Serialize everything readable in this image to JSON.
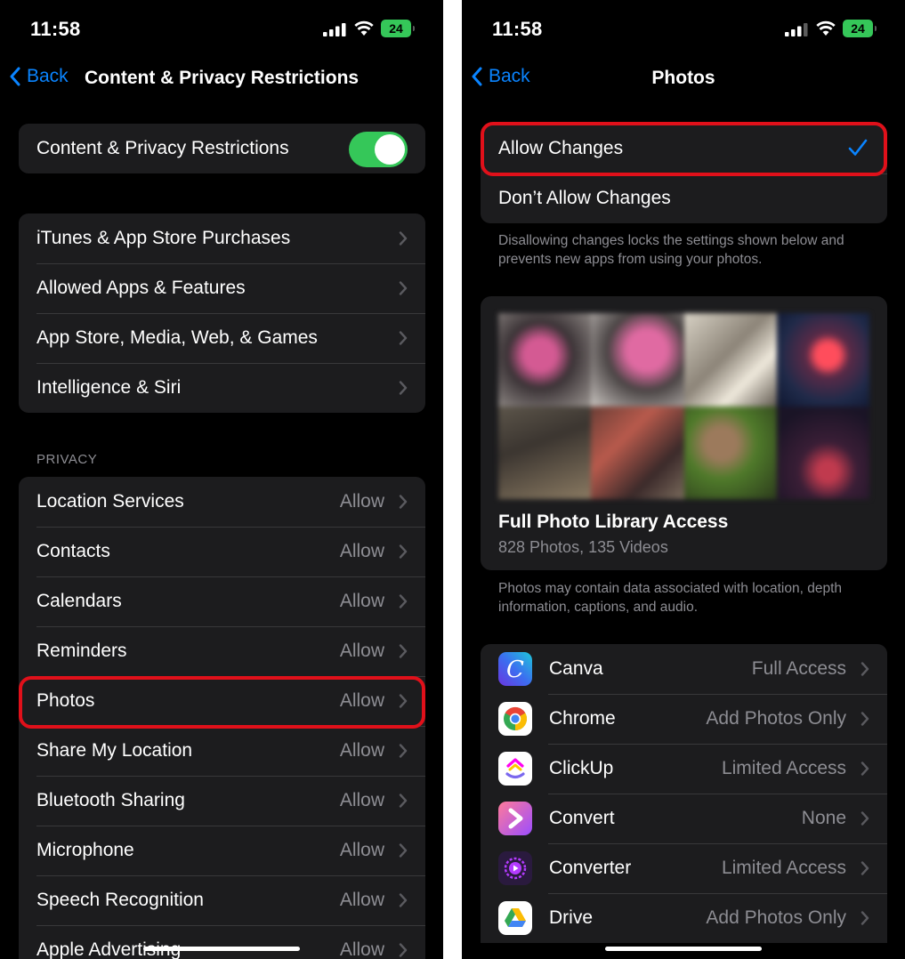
{
  "left": {
    "status": {
      "time": "11:58",
      "battery": "24"
    },
    "nav": {
      "back": "Back",
      "title": "Content & Privacy Restrictions"
    },
    "master": {
      "label": "Content & Privacy Restrictions",
      "enabled": true
    },
    "group1": [
      "iTunes & App Store Purchases",
      "Allowed Apps & Features",
      "App Store, Media, Web, & Games",
      "Intelligence & Siri"
    ],
    "privacy_header": "PRIVACY",
    "privacy": [
      {
        "label": "Location Services",
        "value": "Allow"
      },
      {
        "label": "Contacts",
        "value": "Allow"
      },
      {
        "label": "Calendars",
        "value": "Allow"
      },
      {
        "label": "Reminders",
        "value": "Allow"
      },
      {
        "label": "Photos",
        "value": "Allow"
      },
      {
        "label": "Share My Location",
        "value": "Allow"
      },
      {
        "label": "Bluetooth Sharing",
        "value": "Allow"
      },
      {
        "label": "Microphone",
        "value": "Allow"
      },
      {
        "label": "Speech Recognition",
        "value": "Allow"
      },
      {
        "label": "Apple Advertising",
        "value": "Allow"
      }
    ]
  },
  "right": {
    "status": {
      "time": "11:58",
      "battery": "24"
    },
    "nav": {
      "back": "Back",
      "title": "Photos"
    },
    "options": {
      "allow": "Allow Changes",
      "dont_allow": "Don’t Allow Changes",
      "selected": "allow"
    },
    "options_footer": "Disallowing changes locks the settings shown below and prevents new apps from using your photos.",
    "library": {
      "title": "Full Photo Library Access",
      "counts": "828 Photos, 135 Videos"
    },
    "library_footer": "Photos may contain data associated with location, depth information, captions, and audio.",
    "apps": [
      {
        "name": "Canva",
        "access": "Full Access",
        "icon": "canva-icon"
      },
      {
        "name": "Chrome",
        "access": "Add Photos Only",
        "icon": "chrome-icon"
      },
      {
        "name": "ClickUp",
        "access": "Limited Access",
        "icon": "clickup-icon"
      },
      {
        "name": "Convert",
        "access": "None",
        "icon": "convert-icon"
      },
      {
        "name": "Converter",
        "access": "Limited Access",
        "icon": "converter-icon"
      },
      {
        "name": "Drive",
        "access": "Add Photos Only",
        "icon": "drive-icon"
      }
    ]
  },
  "colors": {
    "accent": "#0a84ff",
    "toggle_on": "#35c759",
    "highlight": "#e0101a",
    "cell": "#1c1c1e",
    "secondary_text": "#8d8d93"
  }
}
